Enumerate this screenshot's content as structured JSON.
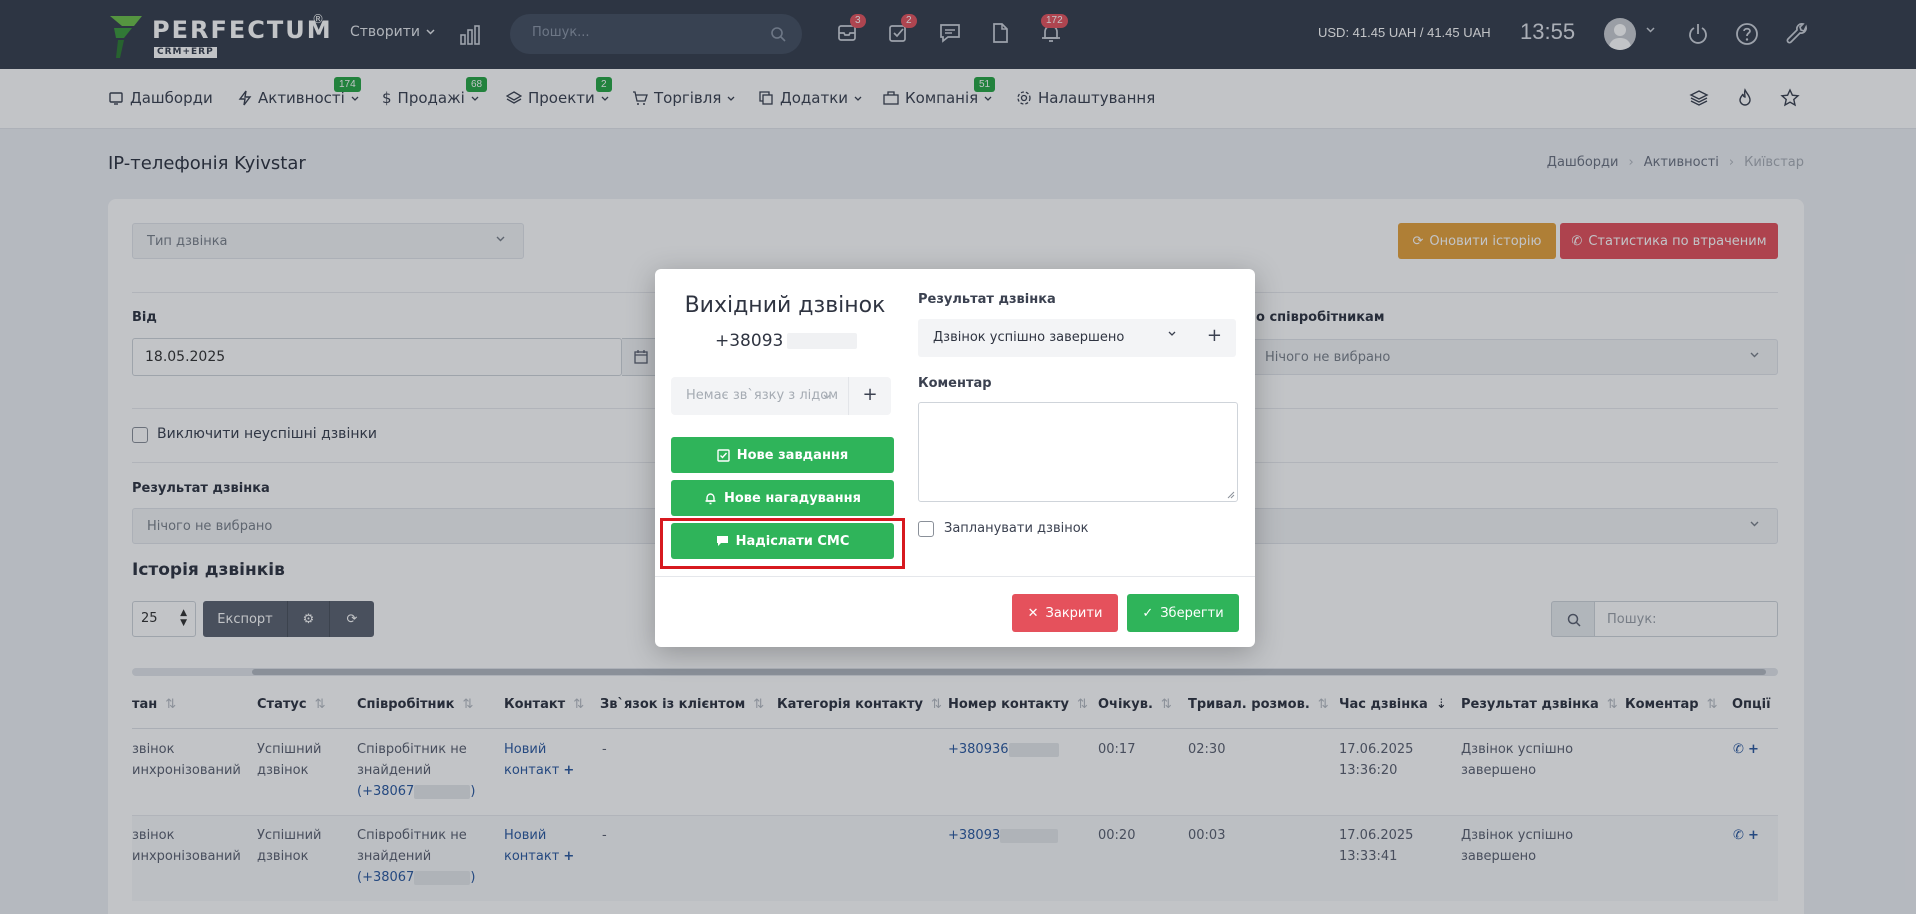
{
  "topbar": {
    "logo": "PERFECTUM",
    "logo_reg": "®",
    "logo_sub": "CRM+ERP",
    "create_label": "Створити",
    "search_placeholder": "Пошук...",
    "badges": {
      "tasks": "3",
      "checks": "2",
      "notifications": "172"
    },
    "currency": "USD: 41.45 UAH / 41.45 UAH",
    "time": "13:55"
  },
  "nav": {
    "items": [
      {
        "label": "Дашборди",
        "icon": "dashboard-icon"
      },
      {
        "label": "Активності",
        "badge": "174",
        "icon": "bolt-icon"
      },
      {
        "label": "Продажі",
        "badge": "68",
        "icon": "dollar-icon"
      },
      {
        "label": "Проекти",
        "badge": "2",
        "icon": "layers-icon"
      },
      {
        "label": "Торгівля",
        "icon": "cart-icon"
      },
      {
        "label": "Додатки",
        "icon": "copy-icon"
      },
      {
        "label": "Компанія",
        "badge": "51",
        "icon": "briefcase-icon"
      },
      {
        "label": "Налаштування",
        "icon": "gear-icon"
      }
    ]
  },
  "page": {
    "title": "IP-телефонія Kyivstar",
    "breadcrumb": [
      "Дашборди",
      "Активності",
      "Київстар"
    ],
    "call_type_placeholder": "Тип дзвінка",
    "refresh_history": "Оновити історію",
    "missed_stats": "Статистика по втраченим",
    "from_label": "Від",
    "from_value": "18.05.2025",
    "by_employee_label": "о співробітникам",
    "nothing_selected": "Нічого не вибрано",
    "exclude_failed": "Виключити неуспішні дзвінки",
    "result_label": "Результат дзвінка",
    "history_title": "Історія дзвінків",
    "page_length": "25",
    "export": "Експорт",
    "search_placeholder": "Пошук:"
  },
  "table": {
    "headers": [
      "тан",
      "Статус",
      "Співробітник",
      "Контакт",
      "Зв`язок із клієнтом",
      "Категорія контакту",
      "Номер контакту",
      "Очікув.",
      "Тривал. розмов.",
      "Час дзвінка",
      "Результат дзвінка",
      "Коментар",
      "Опції"
    ],
    "rows": [
      {
        "state": [
          "звінок",
          "инхронізований"
        ],
        "status": [
          "Успішний",
          "дзвінок"
        ],
        "employee": [
          "Співробітник не",
          "знайдений",
          "(+38067"
        ],
        "employee_end": ")",
        "contact": [
          "Новий",
          "контакт"
        ],
        "link": "-",
        "number": "+380936",
        "wait": "00:17",
        "duration": "02:30",
        "time": [
          "17.06.2025",
          "13:36:20"
        ],
        "result": [
          "Дзвінок успішно",
          "завершено"
        ]
      },
      {
        "state": [
          "звінок",
          "инхронізований"
        ],
        "status": [
          "Успішний",
          "дзвінок"
        ],
        "employee": [
          "Співробітник не",
          "знайдений",
          "(+38067"
        ],
        "employee_end": ")",
        "contact": [
          "Новий",
          "контакт"
        ],
        "link": "-",
        "number": "+38093",
        "wait": "00:20",
        "duration": "00:03",
        "time": [
          "17.06.2025",
          "13:33:41"
        ],
        "result": [
          "Дзвінок успішно",
          "завершено"
        ]
      }
    ]
  },
  "modal": {
    "title": "Вихідний дзвінок",
    "phone": "+38093",
    "lead_placeholder": "Немає зв`язку з лідом",
    "new_task": "Нове завдання",
    "new_reminder": "Нове нагадування",
    "send_sms": "Надіслати СМС",
    "result_label": "Результат дзвінка",
    "result_value": "Дзвінок успішно завершено",
    "comment_label": "Коментар",
    "schedule_call": "Запланувати дзвінок",
    "close": "Закрити",
    "save": "Зберегти"
  }
}
